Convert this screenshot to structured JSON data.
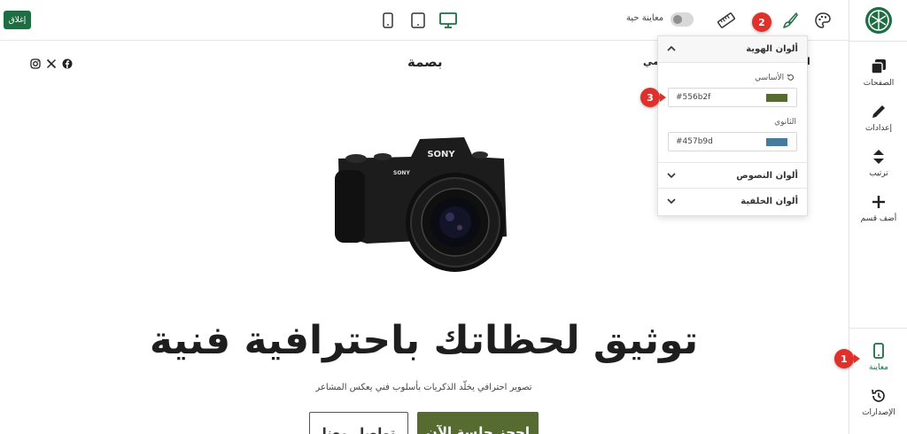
{
  "topbar": {
    "close_label": "إغلاق",
    "live_preview_label": "معاينة حية",
    "devices": [
      "mobile",
      "tablet",
      "desktop"
    ],
    "active_device": "desktop",
    "icons": [
      "ruler-icon",
      "brush-icon",
      "palette-icon"
    ]
  },
  "callouts": {
    "one": "1",
    "two": "2",
    "three": "3"
  },
  "sidebar": {
    "items": [
      {
        "label": "الصفحات",
        "icon": "pages-icon"
      },
      {
        "label": "إعدادات",
        "icon": "pencil-icon"
      },
      {
        "label": "ترتيب",
        "icon": "sort-icon"
      },
      {
        "label": "أضف قسم",
        "icon": "plus-icon"
      },
      {
        "label": "معاينة",
        "icon": "mobile-preview-icon"
      },
      {
        "label": "الإصدارات",
        "icon": "history-icon"
      }
    ]
  },
  "site": {
    "brand": "بصمة",
    "nav_partial_left": "مي",
    "nav_partial_right": "الر",
    "hero_title": "توثيق لحظاتك باحترافية فنية",
    "hero_subtitle": "تصوير احترافي يخلّد الذكريات بأسلوب فني يعكس المشاعر",
    "primary_button": "احجز جلسة الآن",
    "secondary_button": "تواصل معنا"
  },
  "colors_panel": {
    "identity_title": "ألوان الهوية",
    "primary_label": "الأساسي",
    "primary_value": "#556b2f",
    "secondary_label": "الثانوي",
    "secondary_value": "#457b9d",
    "text_colors_title": "ألوان النصوص",
    "background_colors_title": "ألوان الخلفية"
  },
  "theme": {
    "accent": "#1f6e43",
    "primary": "#556b2f",
    "secondary": "#457b9d",
    "badge": "#e0302b"
  }
}
